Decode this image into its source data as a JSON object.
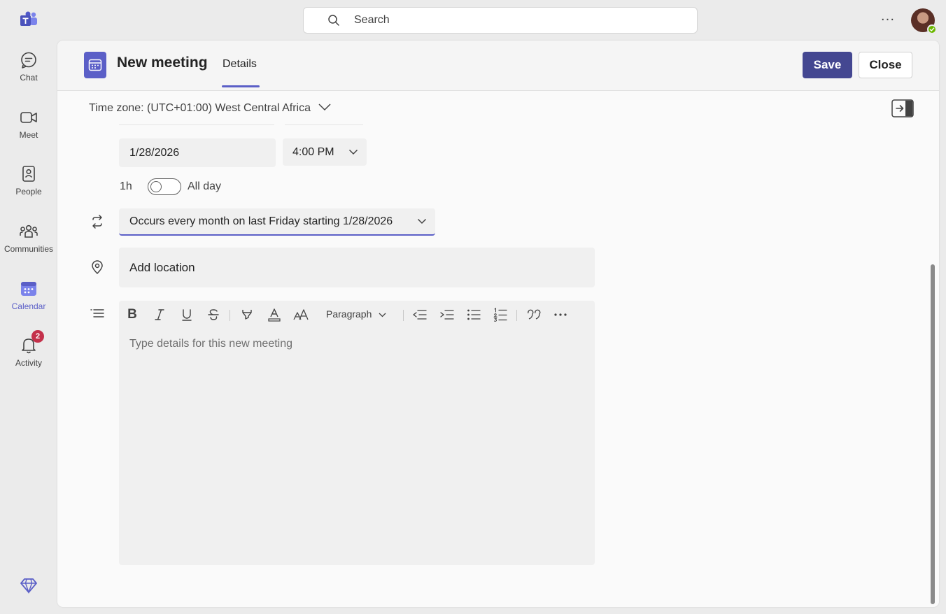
{
  "rail": {
    "items": [
      {
        "label": "Chat",
        "icon": "chat-icon"
      },
      {
        "label": "Meet",
        "icon": "video-camera-icon"
      },
      {
        "label": "People",
        "icon": "contact-card-icon"
      },
      {
        "label": "Communities",
        "icon": "communities-icon"
      },
      {
        "label": "Calendar",
        "icon": "calendar-icon",
        "active": true
      },
      {
        "label": "Activity",
        "icon": "bell-icon",
        "badge": "2"
      }
    ]
  },
  "topbar": {
    "search_placeholder": "Search",
    "more": "···"
  },
  "header": {
    "title": "New meeting",
    "tab": "Details",
    "save_label": "Save",
    "close_label": "Close"
  },
  "form": {
    "timezone": "Time zone: (UTC+01:00) West Central Africa",
    "end_date": "1/28/2026",
    "end_time": "4:00 PM",
    "duration": "1h",
    "all_day_label": "All day",
    "all_day_on": false,
    "recurrence": "Occurs every month on last Friday starting 1/28/2026",
    "location_placeholder": "Add location",
    "editor_placeholder": "Type details for this new meeting",
    "paragraph_style": "Paragraph"
  },
  "colors": {
    "accent": "#5b5fc7",
    "save_bg": "#444791",
    "badge": "#c4314b",
    "presence": "#6bb700"
  }
}
